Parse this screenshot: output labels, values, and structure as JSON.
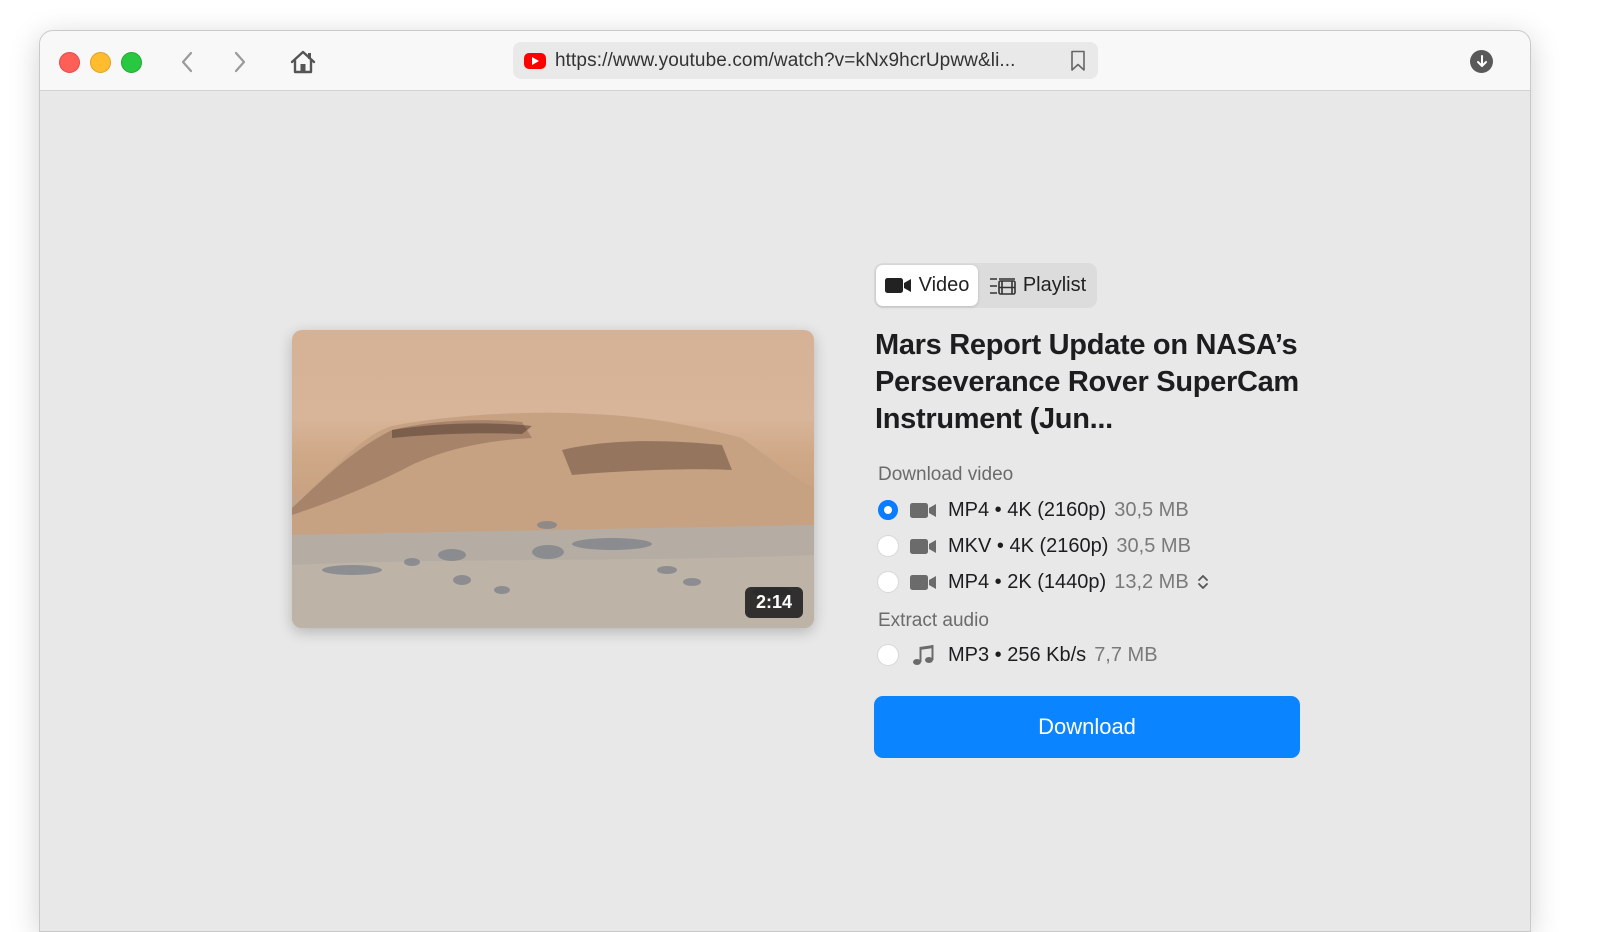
{
  "browser": {
    "url": "https://www.youtube.com/watch?v=kNx9hcrUpww&li...",
    "site_icon": "youtube-icon",
    "buttons": {
      "back": "chevron-left-icon",
      "forward": "chevron-right-icon",
      "home": "home-icon",
      "bookmark": "bookmark-icon",
      "downloads": "download-circle-icon"
    }
  },
  "tabs": {
    "video": "Video",
    "playlist": "Playlist",
    "selected": "video"
  },
  "video": {
    "title": "Mars Report  Update on NASA’s Perseverance Rover SuperCam Instrument (Jun...",
    "duration": "2:14"
  },
  "download_video": {
    "label": "Download video",
    "options": [
      {
        "format": "MP4 • 4K (2160p)",
        "size": "30,5 MB",
        "selected": true
      },
      {
        "format": "MKV • 4K (2160p)",
        "size": "30,5 MB",
        "selected": false
      },
      {
        "format": "MP4 • 2K (1440p)",
        "size": "13,2 MB",
        "selected": false
      }
    ]
  },
  "extract_audio": {
    "label": "Extract audio",
    "options": [
      {
        "format": "MP3 • 256 Kb/s",
        "size": "7,7 MB",
        "selected": false
      }
    ]
  },
  "actions": {
    "download": "Download"
  },
  "colors": {
    "accent": "#0a84ff",
    "youtube_red": "#ff0000",
    "close": "#fe5f57",
    "minimize": "#febc2e",
    "maximize": "#28c840"
  }
}
